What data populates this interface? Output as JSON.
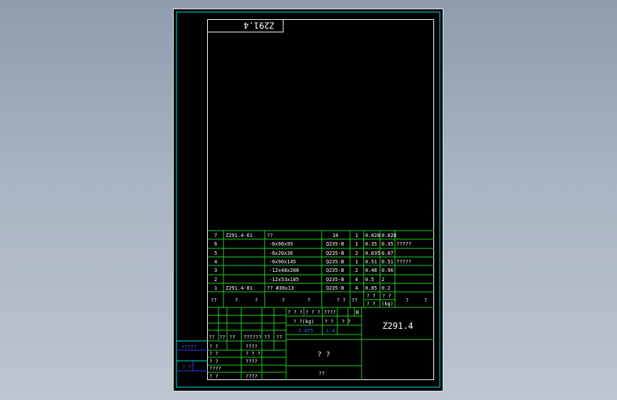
{
  "drawing": {
    "code_top": "Z291.4",
    "code_main": "Z291.4",
    "bom_rows": [
      {
        "no": "7",
        "code": "Z291.4-61",
        "name": "??",
        "spec": "",
        "qty_a": "10",
        "qty_b": "1",
        "w1": "0.028",
        "w2": "0.028",
        "note": ""
      },
      {
        "no": "6",
        "code": "",
        "name": "",
        "spec": "-6x90x95",
        "qty_a": "Q235-B",
        "qty_b": "1",
        "w1": "0.35",
        "w2": "0.35",
        "note": "?????"
      },
      {
        "no": "5",
        "code": "",
        "name": "",
        "spec": "-6x20x36",
        "qty_a": "Q235-B",
        "qty_b": "2",
        "w1": "0.035",
        "w2": "0.07",
        "note": ""
      },
      {
        "no": "4",
        "code": "",
        "name": "",
        "spec": "-6x90x145",
        "qty_a": "Q235-B",
        "qty_b": "1",
        "w1": "0.51",
        "w2": "0.51",
        "note": "?????"
      },
      {
        "no": "3",
        "code": "",
        "name": "",
        "spec": "-12x48x208",
        "qty_a": "Q235-B",
        "qty_b": "2",
        "w1": "0.48",
        "w2": "0.96",
        "note": ""
      },
      {
        "no": "2",
        "code": "",
        "name": "",
        "spec": "-12x53x185",
        "qty_a": "Q235-B",
        "qty_b": "4",
        "w1": "0.5",
        "w2": "2",
        "note": ""
      },
      {
        "no": "1",
        "code": "Z291.4-81",
        "name": "??  #30x13",
        "spec": "",
        "qty_a": "Q235-B",
        "qty_b": "4",
        "w1": "0.05",
        "w2": "0.2",
        "note": ""
      }
    ],
    "bom_header": {
      "h1": "??",
      "h2": "?",
      "h3": "?",
      "h4": "?",
      "h5": "?",
      "h6": "? ?",
      "h7": "??",
      "h8a": "? ?",
      "h8b": "? ?",
      "h9a": "? ?",
      "h9b": "(kg)",
      "h10": "?",
      "h11": "?"
    },
    "title_block": {
      "r1a": "? ? ?",
      "r1b": "? ? ?",
      "r1c": "????",
      "r1d": "B",
      "r2a": "? ?(kg)",
      "r2b": "? ?",
      "r2c": "? ?",
      "scale": "2.475",
      "sheet_no": "1:4",
      "name_big": "?   ?",
      "bottom": "??",
      "rev_row": [
        "??",
        "??",
        "??",
        "??????",
        "??",
        "??"
      ],
      "sig_rows": [
        {
          "a": "? ?",
          "b": "????"
        },
        {
          "a": "? ?",
          "b": "? ? ?"
        },
        {
          "a": "? ?",
          "b": "????"
        },
        {
          "a": "????",
          "b": ""
        },
        {
          "a": "? ?",
          "b": "????"
        }
      ]
    },
    "left_margin": {
      "l1": "?????",
      "l2": "?   ?"
    }
  }
}
